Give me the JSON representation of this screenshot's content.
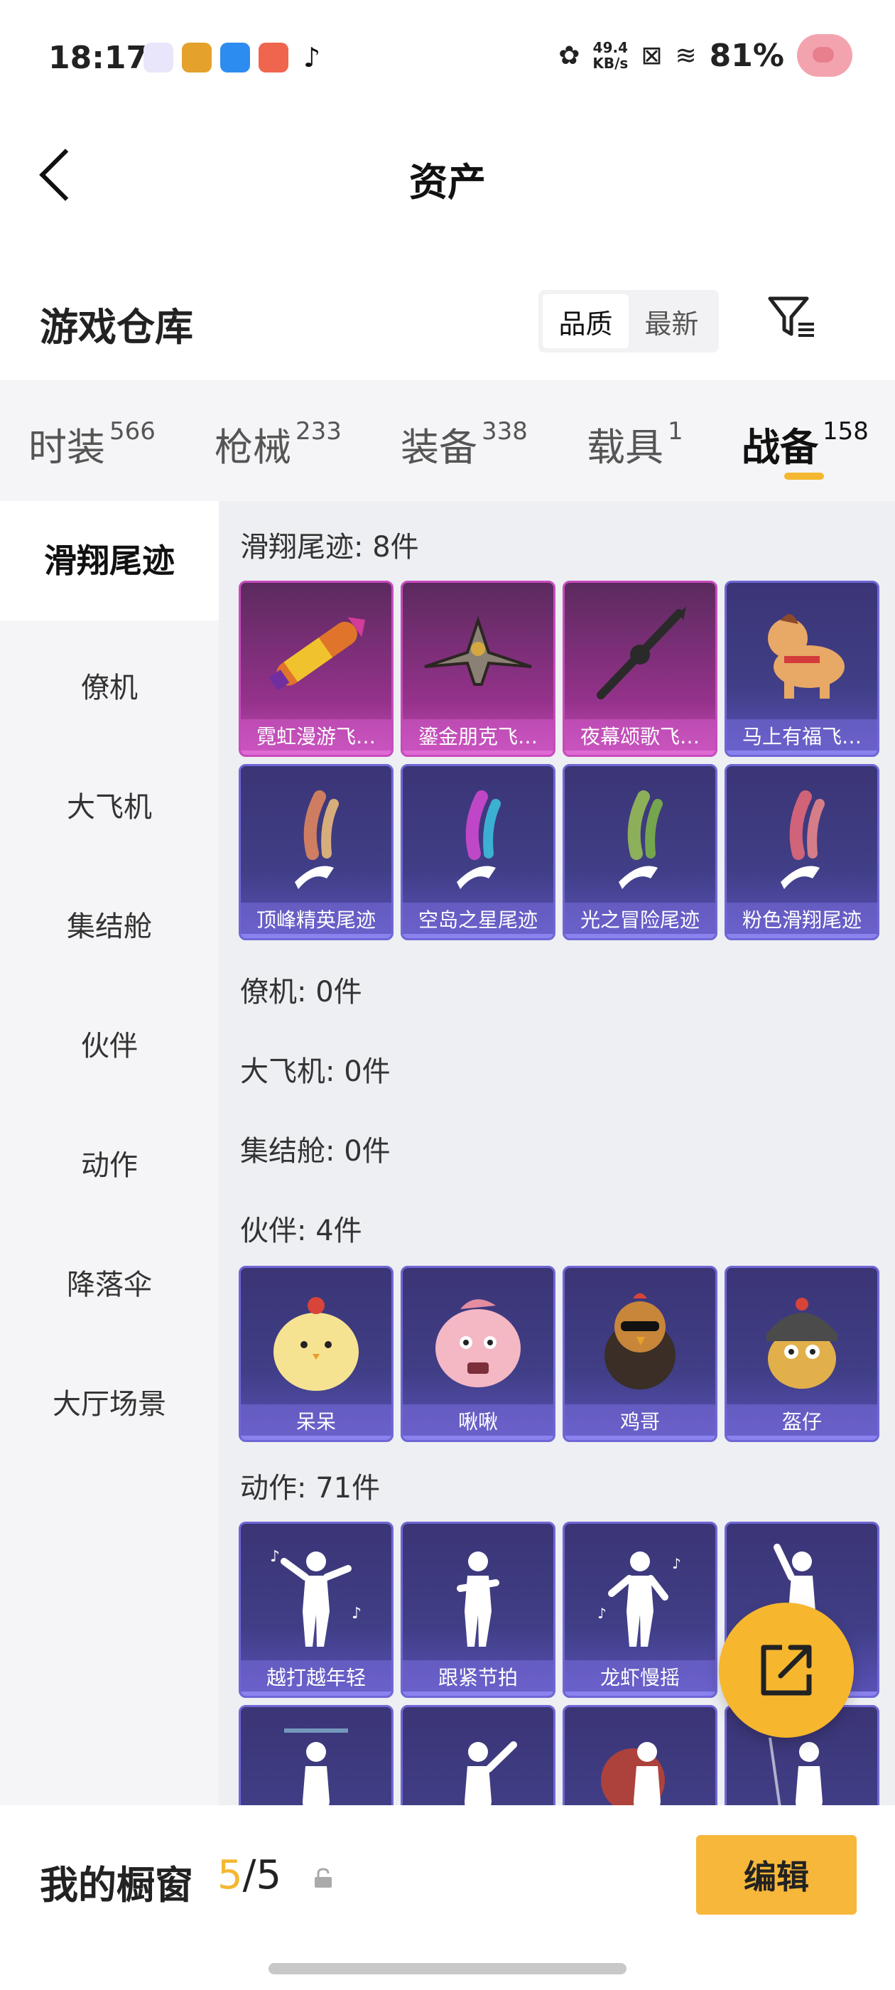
{
  "status_bar": {
    "time": "18:17",
    "speed_value": "49.4",
    "speed_unit": "KB/s",
    "battery": "81%"
  },
  "header": {
    "title": "资产"
  },
  "warehouse": {
    "title": "游戏仓库",
    "sort_options": [
      "品质",
      "最新"
    ],
    "sort_selected": "品质"
  },
  "tabs": [
    {
      "label": "时装",
      "count": "566"
    },
    {
      "label": "枪械",
      "count": "233"
    },
    {
      "label": "装备",
      "count": "338"
    },
    {
      "label": "载具",
      "count": "1"
    },
    {
      "label": "战备",
      "count": "158"
    }
  ],
  "left_nav": [
    "滑翔尾迹",
    "僚机",
    "大飞机",
    "集结舱",
    "伙伴",
    "动作",
    "降落伞",
    "大厅场景"
  ],
  "sections": {
    "glide": {
      "title": "滑翔尾迹: 8件",
      "items": [
        "霓虹漫游飞…",
        "鎏金朋克飞…",
        "夜幕颂歌飞…",
        "马上有福飞…",
        "顶峰精英尾迹",
        "空岛之星尾迹",
        "光之冒险尾迹",
        "粉色滑翔尾迹"
      ]
    },
    "wingman": {
      "title": "僚机: 0件"
    },
    "bigplane": {
      "title": "大飞机: 0件"
    },
    "pod": {
      "title": "集结舱: 0件"
    },
    "partner": {
      "title": "伙伴: 4件",
      "items": [
        "呆呆",
        "啾啾",
        "鸡哥",
        "盔仔"
      ]
    },
    "action": {
      "title": "动作: 71件",
      "items": [
        "越打越年轻",
        "跟紧节拍",
        "龙虾慢摇"
      ]
    }
  },
  "bottom_bar": {
    "title": "我的橱窗",
    "count_used": "5",
    "count_sep": "/",
    "count_total": "5",
    "edit_label": "编辑"
  },
  "colors": {
    "accent": "#f4b731",
    "card_purple": "#403e86",
    "card_pink": "#96328c"
  }
}
